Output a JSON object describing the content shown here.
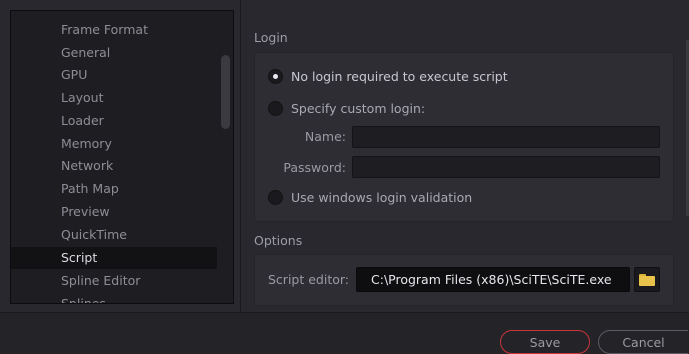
{
  "sidebar": {
    "items": [
      {
        "label": "Frame Format",
        "selected": false
      },
      {
        "label": "General",
        "selected": false
      },
      {
        "label": "GPU",
        "selected": false
      },
      {
        "label": "Layout",
        "selected": false
      },
      {
        "label": "Loader",
        "selected": false
      },
      {
        "label": "Memory",
        "selected": false
      },
      {
        "label": "Network",
        "selected": false
      },
      {
        "label": "Path Map",
        "selected": false
      },
      {
        "label": "Preview",
        "selected": false
      },
      {
        "label": "QuickTime",
        "selected": false
      },
      {
        "label": "Script",
        "selected": true
      },
      {
        "label": "Spline Editor",
        "selected": false
      },
      {
        "label": "Splines",
        "selected": false
      }
    ]
  },
  "login": {
    "title": "Login",
    "options": {
      "no_login": {
        "label": "No login required to execute script",
        "checked": true
      },
      "custom_login": {
        "label": "Specify custom login:",
        "checked": false
      },
      "windows_login": {
        "label": "Use windows login validation",
        "checked": false
      }
    },
    "name_label": "Name:",
    "name_value": "",
    "password_label": "Password:",
    "password_value": ""
  },
  "options": {
    "title": "Options",
    "script_editor_label": "Script editor:",
    "script_editor_value": "C:\\Program Files (x86)\\SciTE\\SciTE.exe",
    "browse_icon": "folder-icon"
  },
  "footer": {
    "save_label": "Save",
    "cancel_label": "Cancel"
  },
  "colors": {
    "accent_save_border": "#c8363a",
    "folder_icon": "#e8c24a",
    "selected_row_bg": "#121214"
  }
}
